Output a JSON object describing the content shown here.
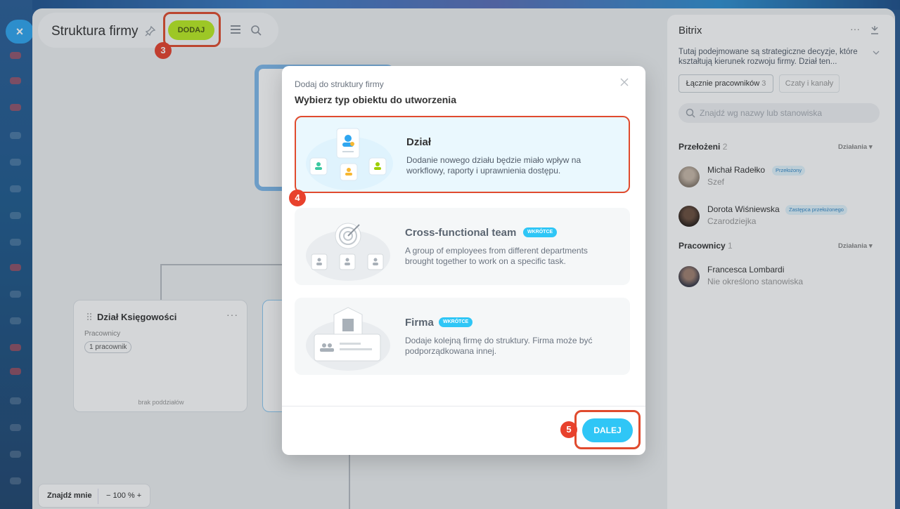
{
  "sidebar": {
    "close_label": "×"
  },
  "header": {
    "title": "Struktura firmy",
    "add_label": "DODAJ"
  },
  "annotations": {
    "step3": "3",
    "step4": "4",
    "step5": "5"
  },
  "org": {
    "dept_title": "Dział Księgowości",
    "dept_employees_label": "Pracownicy",
    "dept_employee_count": "1 pracownik",
    "dept_footer": "brak poddziałów"
  },
  "zoom": {
    "find_me": "Znajdź mnie",
    "level": "− 100 % +"
  },
  "panel": {
    "title": "Bitrix",
    "description": "Tutaj podejmowane są strategiczne decyzje, które kształtują kierunek rozwoju firmy. Dział ten...",
    "tab_employees": "Łącznie pracowników",
    "tab_employees_count": "3",
    "tab_chats": "Czaty i kanały",
    "search_placeholder": "Znajdź wg nazwy lub stanowiska",
    "managers_label": "Przełożeni",
    "managers_count": "2",
    "actions_label": "Działania",
    "employees_label": "Pracownicy",
    "employees_count": "1",
    "managers": [
      {
        "name": "Michał Radełko",
        "tag": "Przełożony",
        "role": "Szef"
      },
      {
        "name": "Dorota Wiśniewska",
        "tag": "Zastępca przełożonego",
        "role": "Czarodziejka"
      }
    ],
    "employees": [
      {
        "name": "Francesca Lombardi",
        "role": "Nie określono stanowiska"
      }
    ]
  },
  "modal": {
    "subtitle": "Dodaj do struktury firmy",
    "title": "Wybierz typ obiektu do utworzenia",
    "options": [
      {
        "title": "Dział",
        "desc": "Dodanie nowego działu będzie miało wpływ na workflowy, raporty i uprawnienia dostępu."
      },
      {
        "title": "Cross-functional team",
        "badge": "WKRÓTCE",
        "desc": "A group of employees from different departments brought together to work on a specific task."
      },
      {
        "title": "Firma",
        "badge": "WKRÓTCE",
        "desc": "Dodaje kolejną firmę do struktury. Firma może być podporządkowana innej."
      }
    ],
    "next_label": "DALEJ"
  },
  "colors": {
    "accent": "#2fc6f6",
    "add_button": "#bbed21",
    "annotation": "#e04b2e"
  }
}
